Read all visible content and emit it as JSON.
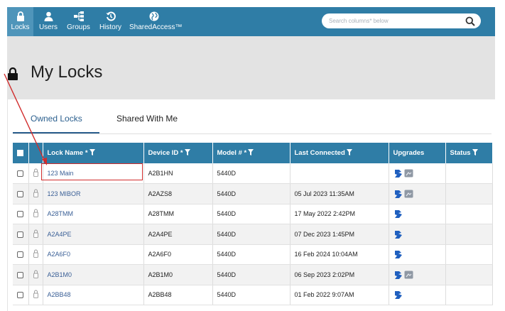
{
  "nav": {
    "items": [
      {
        "label": "Locks",
        "icon": "lock-icon",
        "active": true
      },
      {
        "label": "Users",
        "icon": "user-icon"
      },
      {
        "label": "Groups",
        "icon": "hierarchy-icon"
      },
      {
        "label": "History",
        "icon": "history-icon"
      },
      {
        "label": "SharedAccess™",
        "icon": "globe-icon"
      }
    ],
    "search_placeholder": "Search columns* below"
  },
  "page_title": "My Locks",
  "tabs": [
    {
      "label": "Owned Locks",
      "active": true
    },
    {
      "label": "Shared With Me",
      "active": false
    }
  ],
  "table": {
    "columns": [
      "Lock Name *",
      "Device ID *",
      "Model # *",
      "Last Connected",
      "Upgrades",
      "Status"
    ],
    "rows": [
      {
        "name": "123 Main",
        "device_id": "A2B1HN",
        "model": "5440D",
        "last_connected": "",
        "upgrades": [
          "blue-upgrade-icon",
          "grey-upgrade-icon"
        ],
        "status": ""
      },
      {
        "name": "123 MIBOR",
        "device_id": "A2AZS8",
        "model": "5440D",
        "last_connected": "05 Jul 2023 11:35AM",
        "upgrades": [
          "blue-upgrade-icon",
          "grey-upgrade-icon"
        ],
        "status": ""
      },
      {
        "name": "A28TMM",
        "device_id": "A28TMM",
        "model": "5440D",
        "last_connected": "17 May 2022 2:42PM",
        "upgrades": [
          "blue-upgrade-icon"
        ],
        "status": ""
      },
      {
        "name": "A2A4PE",
        "device_id": "A2A4PE",
        "model": "5440D",
        "last_connected": "07 Dec 2023 1:45PM",
        "upgrades": [
          "blue-upgrade-icon"
        ],
        "status": ""
      },
      {
        "name": "A2A6F0",
        "device_id": "A2A6F0",
        "model": "5440D",
        "last_connected": "16 Feb 2024 10:04AM",
        "upgrades": [
          "blue-upgrade-icon"
        ],
        "status": ""
      },
      {
        "name": "A2B1M0",
        "device_id": "A2B1M0",
        "model": "5440D",
        "last_connected": "06 Sep 2023 2:02PM",
        "upgrades": [
          "blue-upgrade-icon",
          "grey-upgrade-icon"
        ],
        "status": ""
      },
      {
        "name": "A2BB48",
        "device_id": "A2BB48",
        "model": "5440D",
        "last_connected": "01 Feb 2022 9:07AM",
        "upgrades": [
          "blue-upgrade-icon"
        ],
        "status": ""
      }
    ]
  },
  "colors": {
    "nav_bar": "#2f7da6",
    "active_nav": "#4f95ba",
    "link": "#3a5f96",
    "annotation": "#d12c2c"
  }
}
